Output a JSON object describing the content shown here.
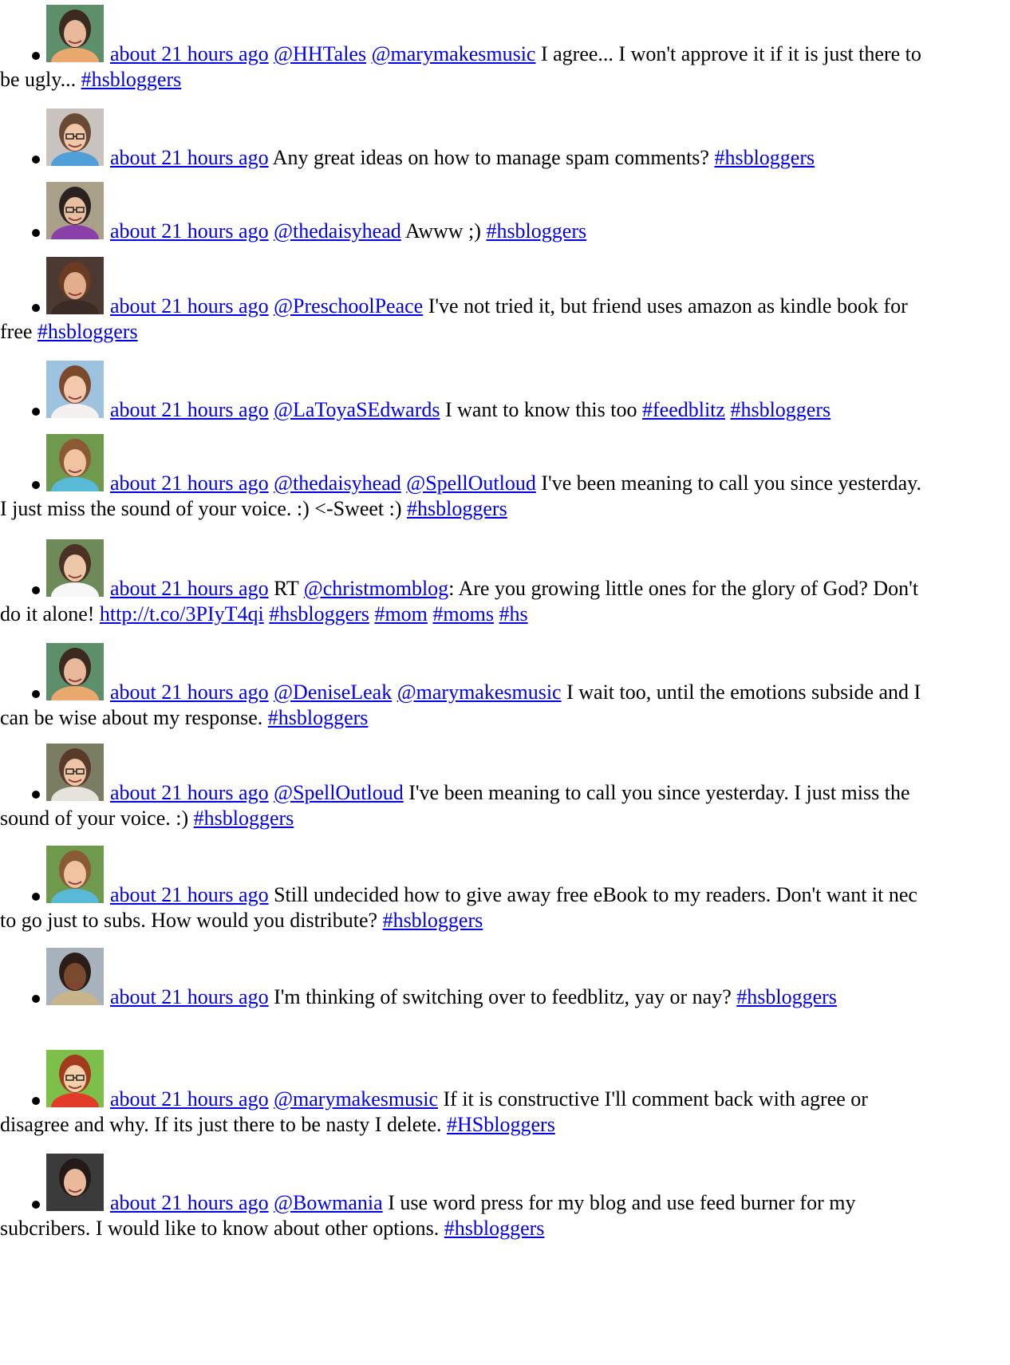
{
  "tweets": [
    {
      "avatar": "woman-dark-hair-portrait",
      "time": "about 21 hours ago",
      "parts": [
        {
          "t": "link",
          "v": "@HHTales"
        },
        {
          "t": "text",
          "v": " "
        },
        {
          "t": "link",
          "v": "@marymakesmusic"
        },
        {
          "t": "text",
          "v": " I agree... I won't approve it if it is just there to be ugly... "
        },
        {
          "t": "link",
          "v": "#hsbloggers"
        }
      ]
    },
    {
      "avatar": "woman-glasses-portrait",
      "time": "about 21 hours ago",
      "parts": [
        {
          "t": "text",
          "v": "Any great ideas on how to manage spam comments? "
        },
        {
          "t": "link",
          "v": "#hsbloggers"
        }
      ]
    },
    {
      "avatar": "smiling-woman-glasses-portrait",
      "time": "about 21 hours ago",
      "parts": [
        {
          "t": "link",
          "v": "@thedaisyhead"
        },
        {
          "t": "text",
          "v": " Awww ;) "
        },
        {
          "t": "link",
          "v": "#hsbloggers"
        }
      ]
    },
    {
      "avatar": "woman-brown-hair-portrait",
      "time": "about 21 hours ago",
      "parts": [
        {
          "t": "link",
          "v": "@PreschoolPeace"
        },
        {
          "t": "text",
          "v": " I've not tried it, but friend uses amazon as kindle book for free "
        },
        {
          "t": "link",
          "v": "#hsbloggers"
        }
      ]
    },
    {
      "avatar": "woman-pink-border-portrait",
      "time": "about 21 hours ago",
      "parts": [
        {
          "t": "link",
          "v": "@LaToyaSEdwards"
        },
        {
          "t": "text",
          "v": " I want to know this too "
        },
        {
          "t": "link",
          "v": "#feedblitz"
        },
        {
          "t": "text",
          "v": " "
        },
        {
          "t": "link",
          "v": "#hsbloggers"
        }
      ]
    },
    {
      "avatar": "woman-outdoors-portrait",
      "time": "about 21 hours ago",
      "parts": [
        {
          "t": "link",
          "v": "@thedaisyhead"
        },
        {
          "t": "text",
          "v": " "
        },
        {
          "t": "link",
          "v": "@SpellOutloud"
        },
        {
          "t": "text",
          "v": " I've been meaning to call you since yesterday. I just miss the sound of your voice. :) <-Sweet :) "
        },
        {
          "t": "link",
          "v": "#hsbloggers"
        }
      ]
    },
    {
      "avatar": "woman-white-top-portrait",
      "time": "about 21 hours ago",
      "parts": [
        {
          "t": "text",
          "v": "RT "
        },
        {
          "t": "link",
          "v": "@christmomblog"
        },
        {
          "t": "text",
          "v": ": Are you growing little ones for the glory of God? Don't do it alone! "
        },
        {
          "t": "link",
          "v": "http://t.co/3PIyT4qi"
        },
        {
          "t": "text",
          "v": " "
        },
        {
          "t": "link",
          "v": "#hsbloggers"
        },
        {
          "t": "text",
          "v": " "
        },
        {
          "t": "link",
          "v": "#mom"
        },
        {
          "t": "text",
          "v": " "
        },
        {
          "t": "link",
          "v": "#moms"
        },
        {
          "t": "text",
          "v": " "
        },
        {
          "t": "link",
          "v": "#hs"
        }
      ]
    },
    {
      "avatar": "woman-dark-hair-portrait",
      "time": "about 21 hours ago",
      "parts": [
        {
          "t": "link",
          "v": "@DeniseLeak"
        },
        {
          "t": "text",
          "v": " "
        },
        {
          "t": "link",
          "v": "@marymakesmusic"
        },
        {
          "t": "text",
          "v": " I wait too, until the emotions subside and I can be wise about my response. "
        },
        {
          "t": "link",
          "v": "#hsbloggers"
        }
      ]
    },
    {
      "avatar": "woman-glasses-logo-portrait",
      "time": "about 21 hours ago",
      "parts": [
        {
          "t": "link",
          "v": "@SpellOutloud"
        },
        {
          "t": "text",
          "v": " I've been meaning to call you since yesterday. I just miss the sound of your voice. :) "
        },
        {
          "t": "link",
          "v": "#hsbloggers"
        }
      ]
    },
    {
      "avatar": "woman-outdoors-portrait",
      "time": "about 21 hours ago",
      "parts": [
        {
          "t": "text",
          "v": "Still undecided how to give away free eBook to my readers. Don't want it nec to go just to subs. How would you distribute? "
        },
        {
          "t": "link",
          "v": "#hsbloggers"
        }
      ]
    },
    {
      "avatar": "smiling-woman-portrait",
      "time": "about 21 hours ago",
      "parts": [
        {
          "t": "text",
          "v": "I'm thinking of switching over to feedblitz, yay or nay? "
        },
        {
          "t": "link",
          "v": "#hsbloggers"
        }
      ]
    },
    {
      "avatar": "cartoon-person-glasses",
      "time": "about 21 hours ago",
      "parts": [
        {
          "t": "link",
          "v": "@marymakesmusic"
        },
        {
          "t": "text",
          "v": " If it is constructive I'll comment back with agree or disagree and why. If its just there to be nasty I delete. "
        },
        {
          "t": "link",
          "v": "#HSbloggers"
        }
      ]
    },
    {
      "avatar": "woman-dark-bob-portrait",
      "time": "about 21 hours ago",
      "parts": [
        {
          "t": "link",
          "v": "@Bowmania"
        },
        {
          "t": "text",
          "v": " I use word press for my blog and use feed burner for my subcribers. I would like to know about other options. "
        },
        {
          "t": "link",
          "v": "#hsbloggers"
        }
      ]
    }
  ],
  "colors": {
    "link": "#0000ee",
    "text": "#000000",
    "background": "#ffffff"
  }
}
